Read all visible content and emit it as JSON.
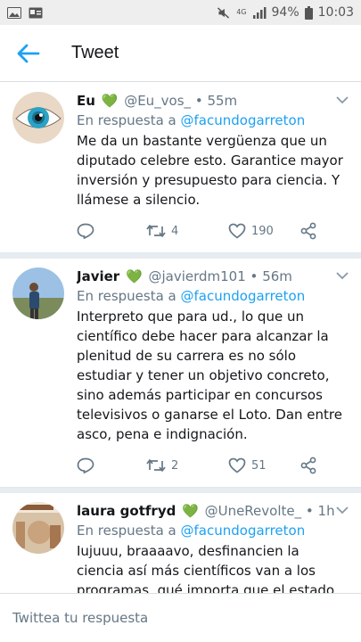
{
  "status_bar": {
    "network": "4G",
    "battery": "94%",
    "time": "10:03"
  },
  "header": {
    "title": "Tweet"
  },
  "tweets": [
    {
      "name": "Eu",
      "emoji": "💚",
      "handle": "@Eu_vos_",
      "dot": "•",
      "time": "55m",
      "reply_prefix": "En respuesta a",
      "reply_to": "@facundogarreton",
      "text": "Me da un bastante vergüenza que un diputado celebre esto. Garantice mayor inversión y presupuesto para ciencia. Y llámese a silencio.",
      "retweets": "4",
      "likes": "190"
    },
    {
      "name": "Javier",
      "emoji": "💚",
      "handle": "@javierdm101",
      "dot": "•",
      "time": "56m",
      "reply_prefix": "En respuesta a",
      "reply_to": "@facundogarreton",
      "text": "Interpreto que para ud., lo que un científico debe hacer para alcanzar la plenitud de su carrera es no sólo estudiar y tener un objetivo concreto, sino además participar en concursos televisivos o ganarse el Loto. Dan entre asco, pena e indignación.",
      "retweets": "2",
      "likes": "51"
    },
    {
      "name": "laura gotfryd",
      "emoji": "💚",
      "handle": "@UneRevolte_",
      "dot": "•",
      "time": "1h",
      "reply_prefix": "En respuesta a",
      "reply_to": "@facundogarreton",
      "text": "Iujuuu, braaaavo, desfinancien la ciencia así más científicos van a los programas, qué importa que el estado recorte en estudios",
      "retweets": "",
      "likes": ""
    }
  ],
  "reply_bar": {
    "placeholder": "Twittea tu respuesta"
  },
  "colors": {
    "accent": "#1da1f2",
    "muted": "#657786",
    "heart": "#77b255"
  }
}
